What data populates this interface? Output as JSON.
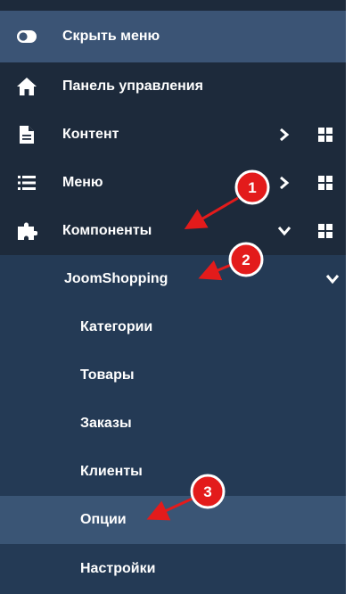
{
  "menu": {
    "hide_label": "Скрыть меню",
    "items": [
      {
        "label": "Панель управления"
      },
      {
        "label": "Контент"
      },
      {
        "label": "Меню"
      },
      {
        "label": "Компоненты"
      }
    ],
    "component": {
      "label": "JoomShopping"
    },
    "subitems": [
      {
        "label": "Категории"
      },
      {
        "label": "Товары"
      },
      {
        "label": "Заказы"
      },
      {
        "label": "Клиенты"
      },
      {
        "label": "Опции"
      },
      {
        "label": "Настройки"
      }
    ]
  },
  "callouts": [
    {
      "number": "1"
    },
    {
      "number": "2"
    },
    {
      "number": "3"
    }
  ],
  "colors": {
    "sidebar_bg": "#1d2a3b",
    "submenu_bg": "#243a55",
    "active_bg": "#3a5575",
    "hide_bg": "#3b5475",
    "callout": "#e31b1b"
  }
}
